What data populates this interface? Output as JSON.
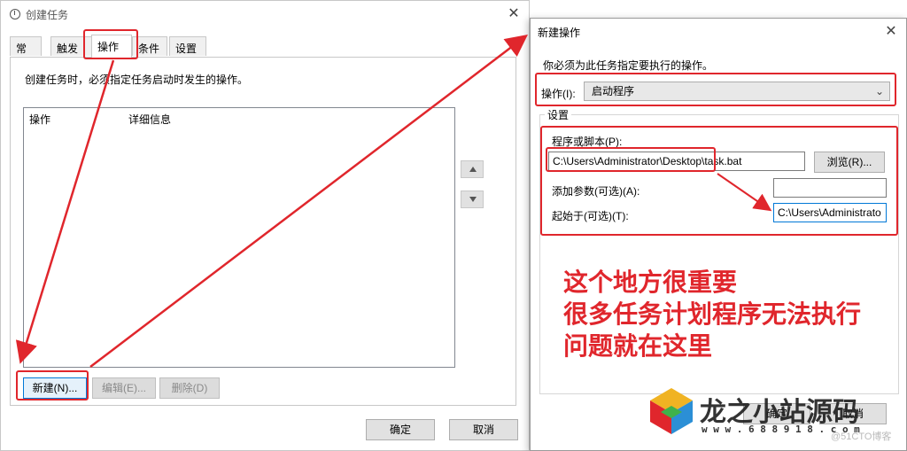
{
  "left_window": {
    "title": "创建任务",
    "close": "✕",
    "tabs": [
      "常规",
      "触发器",
      "操作",
      "条件",
      "设置"
    ],
    "active_tab": "操作",
    "description": "创建任务时，必须指定任务启动时发生的操作。",
    "columns": [
      "操作",
      "详细信息"
    ],
    "buttons": {
      "new": "新建(N)...",
      "edit": "编辑(E)...",
      "delete": "删除(D)"
    },
    "footer": {
      "ok": "确定",
      "cancel": "取消"
    }
  },
  "right_window": {
    "title": "新建操作",
    "close": "✕",
    "instruction": "你必须为此任务指定要执行的操作。",
    "action_label": "操作(I):",
    "action_value": "启动程序",
    "settings_group": "设置",
    "program_label": "程序或脚本(P):",
    "program_value": "C:\\Users\\Administrator\\Desktop\\task.bat",
    "browse_button": "浏览(R)...",
    "args_label": "添加参数(可选)(A):",
    "args_value": "",
    "startin_label": "起始于(可选)(T):",
    "startin_value": "C:\\Users\\Administrato",
    "footer": {
      "ok": "确定",
      "cancel": "取消"
    }
  },
  "annotation": {
    "lines": [
      "这个地方很重要",
      "很多任务计划程序无法执行",
      "问题就在这里"
    ],
    "color": "#e0262c"
  },
  "watermark": {
    "brand": "龙之小站源码",
    "url": "w w w . 6 8 8 9 1 8 . c o m",
    "credit": "@51CTO博客"
  }
}
